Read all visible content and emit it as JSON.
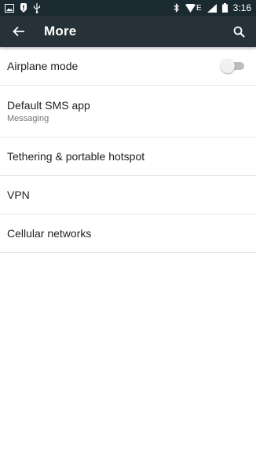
{
  "status_bar": {
    "time": "3:16",
    "network_type": "E",
    "left_icons": [
      "image-icon",
      "alert-icon",
      "usb-icon"
    ],
    "right_icons": [
      "bluetooth-icon",
      "wifi-icon",
      "signal-icon",
      "battery-icon"
    ]
  },
  "toolbar": {
    "title": "More",
    "back_icon": "arrow-back-icon",
    "search_icon": "search-icon",
    "background": "#263238"
  },
  "settings": [
    {
      "label": "Airplane mode",
      "toggle": "off"
    },
    {
      "label": "Default SMS app",
      "summary": "Messaging"
    },
    {
      "label": "Tethering & portable hotspot"
    },
    {
      "label": "VPN"
    },
    {
      "label": "Cellular networks"
    }
  ]
}
